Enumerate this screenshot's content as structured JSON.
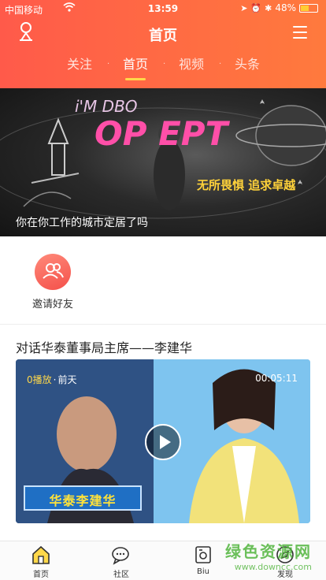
{
  "status_bar": {
    "carrier": "中国移动",
    "time": "13:59",
    "battery": "48%"
  },
  "header": {
    "title": "首页",
    "tabs": [
      {
        "label": "关注",
        "active": false
      },
      {
        "label": "首页",
        "active": true
      },
      {
        "label": "视频",
        "active": false
      },
      {
        "label": "头条",
        "active": false
      }
    ],
    "tab_separator": "·"
  },
  "banner": {
    "caption": "你在你工作的城市定居了吗",
    "art_text_top": "i'M DBO",
    "art_text_main": "OP EPT",
    "art_text_right": "无所畏惧 追求卓越"
  },
  "invite": {
    "label": "邀请好友"
  },
  "article": {
    "title": "对话华泰董事局主席——李建华",
    "plays": "0播放",
    "separator": "·",
    "when": "前天",
    "duration": "00:05:11",
    "caption_strip": "华泰李建华"
  },
  "bottom_nav": [
    {
      "label": "首页",
      "icon": "home-icon"
    },
    {
      "label": "社区",
      "icon": "chat-bubbles-icon"
    },
    {
      "label": "Biu",
      "icon": "camera-box-icon"
    },
    {
      "label": "发现",
      "icon": "compass-icon"
    }
  ],
  "watermark": {
    "line1": "绿色资源网",
    "line2": "www.downcc.com"
  },
  "colors": {
    "header_gradient_start": "#ff5a4a",
    "header_gradient_end": "#ff7a3d",
    "active_tab_underline": "#ffd84a",
    "invite_button": "#f4504a"
  }
}
